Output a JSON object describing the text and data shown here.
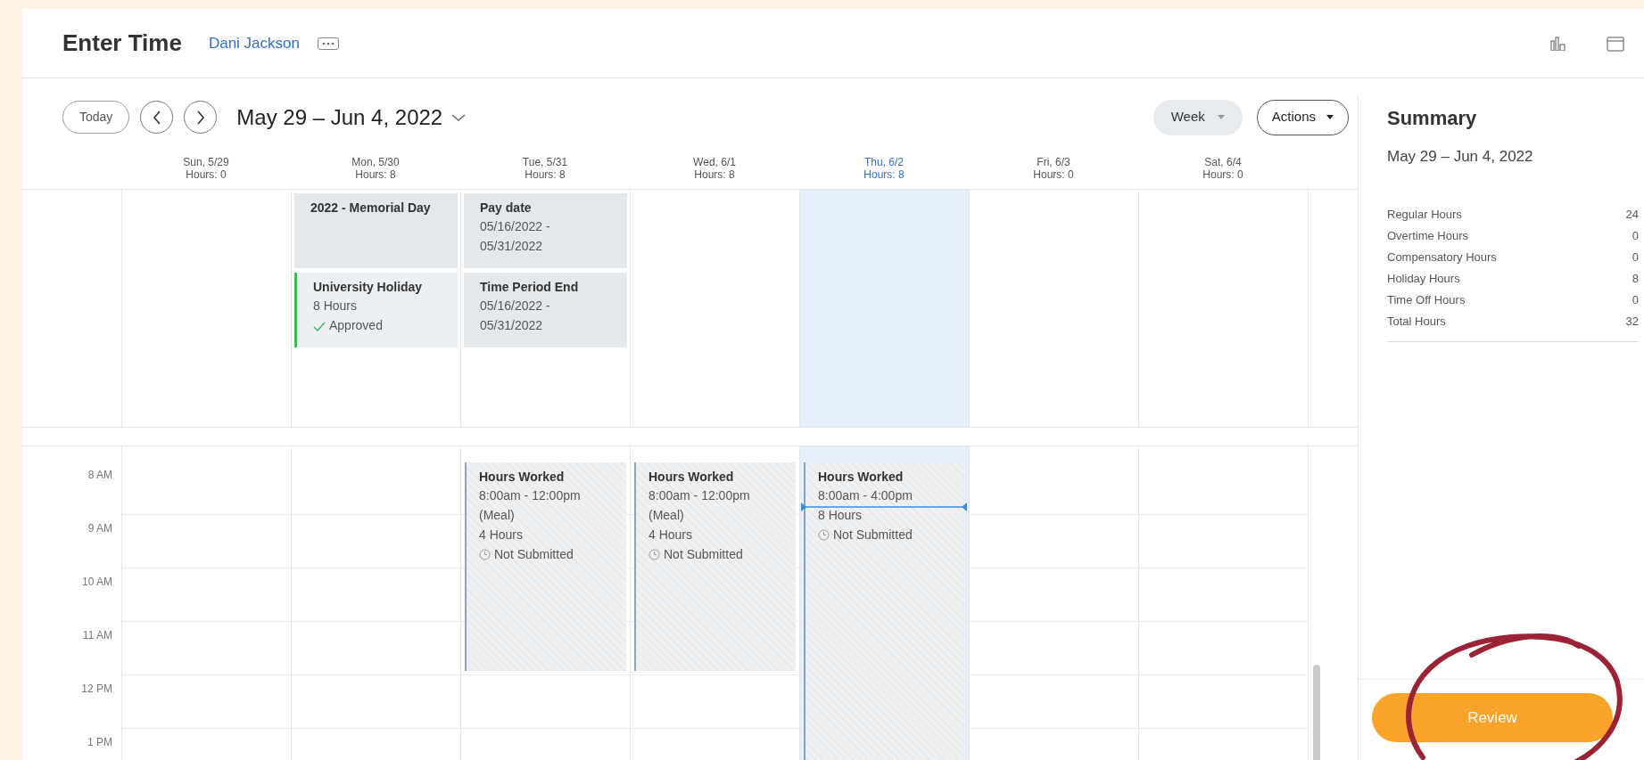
{
  "header": {
    "title": "Enter Time",
    "worker": "Dani Jackson"
  },
  "toolbar": {
    "today": "Today",
    "range": "May 29 – Jun 4, 2022",
    "view": "Week",
    "actions": "Actions"
  },
  "days": [
    {
      "label": "Sun, 5/29",
      "hours": "Hours: 0",
      "today": false
    },
    {
      "label": "Mon, 5/30",
      "hours": "Hours: 8",
      "today": false,
      "all_day": [
        {
          "kind": "info",
          "title": "2022 - Memorial Day"
        },
        {
          "kind": "approved",
          "title": "University Holiday",
          "lines": [
            "8 Hours"
          ],
          "status": "Approved"
        }
      ]
    },
    {
      "label": "Tue, 5/31",
      "hours": "Hours: 8",
      "today": false,
      "all_day": [
        {
          "kind": "info",
          "title": "Pay date",
          "lines": [
            "05/16/2022 -",
            "05/31/2022"
          ]
        },
        {
          "kind": "info",
          "title": "Time Period End",
          "lines": [
            "05/16/2022 -",
            "05/31/2022"
          ]
        }
      ],
      "events": [
        {
          "title": "Hours Worked",
          "lines": [
            "8:00am - 12:00pm",
            "(Meal)"
          ],
          "hours": "4 Hours",
          "status": "Not Submitted",
          "selected": false
        }
      ]
    },
    {
      "label": "Wed, 6/1",
      "hours": "Hours: 8",
      "today": false,
      "events": [
        {
          "title": "Hours Worked",
          "lines": [
            "8:00am - 12:00pm",
            "(Meal)"
          ],
          "hours": "4 Hours",
          "status": "Not Submitted",
          "selected": false
        }
      ]
    },
    {
      "label": "Thu, 6/2",
      "hours": "Hours: 8",
      "today": true,
      "events": [
        {
          "title": "Hours Worked",
          "lines": [
            "8:00am - 4:00pm"
          ],
          "hours": "8 Hours",
          "status": "Not Submitted",
          "selected": true
        }
      ]
    },
    {
      "label": "Fri, 6/3",
      "hours": "Hours: 0",
      "today": false
    },
    {
      "label": "Sat, 6/4",
      "hours": "Hours: 0",
      "today": false
    }
  ],
  "time_labels": [
    "8 AM",
    "9 AM",
    "10 AM",
    "11 AM",
    "12 PM",
    "1 PM"
  ],
  "summary": {
    "title": "Summary",
    "range": "May 29 – Jun 4, 2022",
    "rows": [
      {
        "label": "Regular Hours",
        "value": "24"
      },
      {
        "label": "Overtime Hours",
        "value": "0"
      },
      {
        "label": "Compensatory Hours",
        "value": "0"
      },
      {
        "label": "Holiday Hours",
        "value": "8"
      },
      {
        "label": "Time Off Hours",
        "value": "0"
      },
      {
        "label": "Total Hours",
        "value": "32"
      }
    ],
    "button": "Review"
  }
}
